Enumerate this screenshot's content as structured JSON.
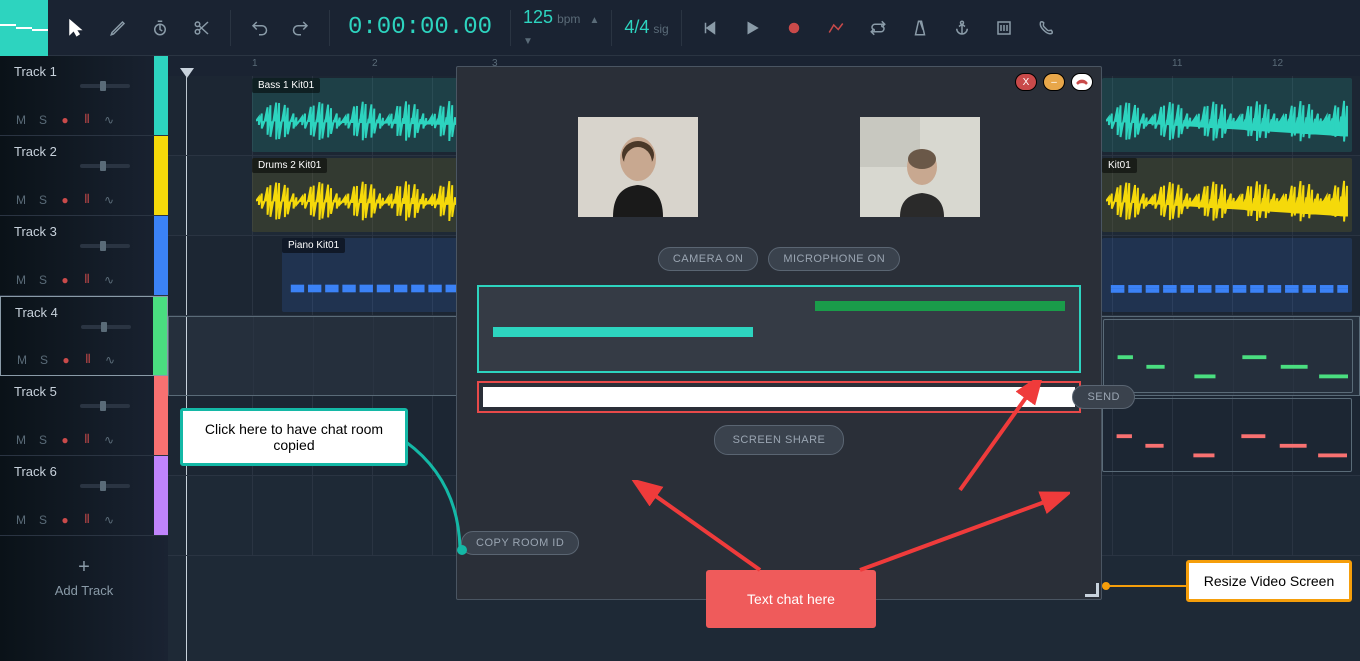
{
  "toolbar": {
    "time": "0:00:00.00",
    "bpm_value": "125",
    "bpm_label": "bpm",
    "sig_value": "4/4",
    "sig_label": "sig"
  },
  "tracks": [
    {
      "name": "Track 1",
      "color": "#2dd4bf",
      "clip_label": "Bass 1 Kit01"
    },
    {
      "name": "Track 2",
      "color": "#f5d90a",
      "clip_label": "Drums 2 Kit01"
    },
    {
      "name": "Track 3",
      "color": "#3b82f6",
      "clip_label": "Piano Kit01"
    },
    {
      "name": "Track 4",
      "color": "#4ade80",
      "clip_label": ""
    },
    {
      "name": "Track 5",
      "color": "#f87171",
      "clip_label": ""
    },
    {
      "name": "Track 6",
      "color": "#c084fc",
      "clip_label": ""
    }
  ],
  "add_track_label": "Add Track",
  "ruler_marks": [
    "1",
    "2",
    "3",
    "11",
    "12"
  ],
  "modal": {
    "camera_btn": "CAMERA ON",
    "mic_btn": "MICROPHONE ON",
    "send_btn": "SEND",
    "screen_share_btn": "SCREEN SHARE",
    "copy_room_btn": "COPY ROOM ID",
    "clip_right_label": "Kit01"
  },
  "callouts": {
    "copy_room": "Click here to have chat room copied",
    "text_chat": "Text chat here",
    "resize": "Resize Video Screen"
  }
}
